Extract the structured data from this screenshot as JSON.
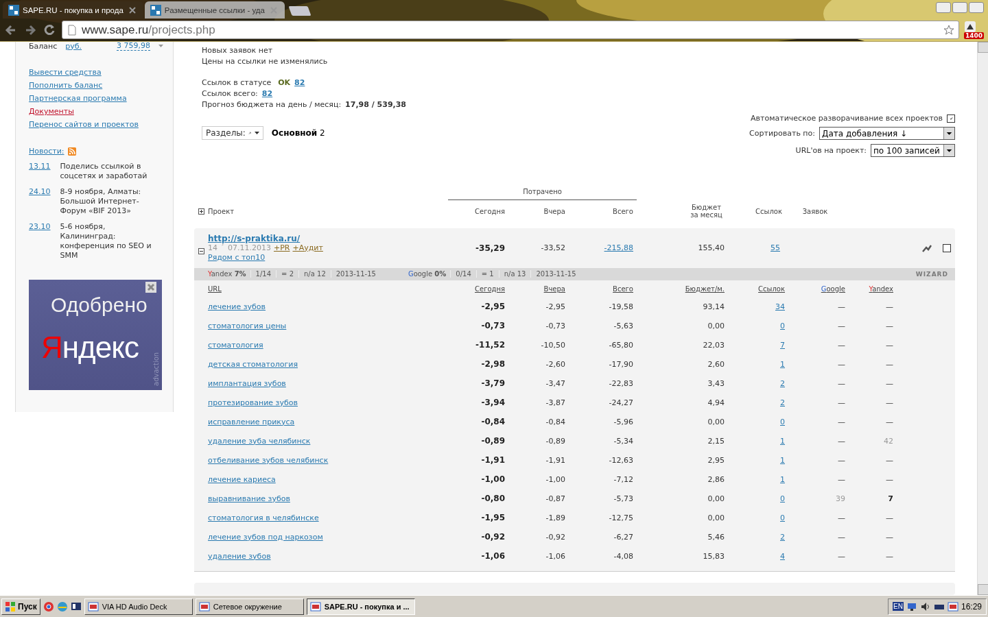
{
  "browser": {
    "tabs": [
      {
        "title": "SAPE.RU - покупка и прода",
        "selected": true
      },
      {
        "title": "Размещенные ссылки - уда",
        "selected": false
      }
    ],
    "url_host": "www.sape.ru",
    "url_path": "/projects.php",
    "extension_badge": "1400"
  },
  "sidebar": {
    "balance_label": "Баланс",
    "currency": "руб.",
    "balance": "3 759,98",
    "links": [
      {
        "label": "Вывести средства",
        "active": false
      },
      {
        "label": "Пополнить баланс",
        "active": false
      },
      {
        "label": "Партнерская программа",
        "active": false
      },
      {
        "label": "Документы",
        "active": true
      },
      {
        "label": "Перенос сайтов и проектов",
        "active": false
      }
    ],
    "news_title": "Новости:",
    "news": [
      {
        "date": "13.11",
        "text": "Поделись ссылкой в соцсетях и заработай"
      },
      {
        "date": "24.10",
        "text": "8-9 ноября, Алматы: Большой Интернет-Форум «BIF 2013»"
      },
      {
        "date": "23.10",
        "text": "5-6 ноября, Калининград: конференция по SEO и SMM"
      }
    ],
    "ad": {
      "line1": "Одобрено",
      "brand_initial": "Я",
      "brand_rest": "ндекс",
      "side": "advaction"
    }
  },
  "summary": {
    "lines": [
      "Новых заявок нет",
      "Цены на ссылки не изменялись"
    ],
    "status_label": "Ссылок в статусе",
    "status": "OK",
    "status_count": "82",
    "total_label": "Ссылок всего:",
    "total": "82",
    "forecast_label": "Прогноз бюджета на день / месяц:",
    "forecast": "17,98 / 539,38"
  },
  "controls": {
    "auto_expand": {
      "label": "Автоматическое разворачивание всех проектов",
      "checked": true
    },
    "sections_button": "Разделы:",
    "section_name": "Основной",
    "section_count": "2",
    "sort": {
      "label": "Сортировать по:",
      "value": "Дата добавления ↓"
    },
    "per_project": {
      "label": "URL'ов на проект:",
      "value": "по 100 записей"
    }
  },
  "table": {
    "group_header": "Потрачено",
    "columns": [
      "Проект",
      "Сегодня",
      "Вчера",
      "Всего",
      "Бюджет за месяц",
      "Ссылок",
      "Заявок"
    ],
    "project": {
      "url": "http://s-praktika.ru/",
      "expanded": true,
      "id": "14",
      "date": "07.11.2013",
      "tags": [
        "+PR",
        "+Аудит"
      ],
      "position": "Рядом с топ10",
      "today": "-35,29",
      "yesterday": "-33,52",
      "total": "-215,88",
      "budget": "155,40",
      "links": "55",
      "checked": false,
      "stats": [
        {
          "kind": "yandex",
          "initial": "Y",
          "rest": "andex",
          "percent": "7%",
          "items": [
            "1/14",
            "= 2",
            "n/a 12",
            "2013-11-15"
          ]
        },
        {
          "kind": "google",
          "initial": "G",
          "rest": "oogle",
          "percent": "0%",
          "items": [
            "0/14",
            "= 1",
            "n/a 13",
            "2013-11-15"
          ]
        }
      ],
      "wizard": "WIZARD"
    },
    "url_columns": [
      {
        "kind": "plain",
        "label": "URL"
      },
      {
        "kind": "plain",
        "label": "Сегодня"
      },
      {
        "kind": "plain",
        "label": "Вчера"
      },
      {
        "kind": "plain",
        "label": "Всего"
      },
      {
        "kind": "plain",
        "label": "Бюджет/м."
      },
      {
        "kind": "plain",
        "label": "Ссылок"
      },
      {
        "kind": "google",
        "initial": "G",
        "rest": "oogle"
      },
      {
        "kind": "yandex",
        "initial": "Y",
        "rest": "andex"
      }
    ],
    "rows": [
      {
        "keyword": "лечение зубов",
        "today": "-2,95",
        "yesterday": "-2,95",
        "total": "-19,58",
        "budget": "93,14",
        "links": "34",
        "google": {
          "value": "—",
          "kind": "none"
        },
        "yandex": {
          "value": "—",
          "kind": "none"
        }
      },
      {
        "keyword": "стоматология цены",
        "today": "-0,73",
        "yesterday": "-0,73",
        "total": "-5,63",
        "budget": "0,00",
        "links": "0",
        "google": {
          "value": "—",
          "kind": "none"
        },
        "yandex": {
          "value": "—",
          "kind": "none"
        }
      },
      {
        "keyword": "стоматология",
        "today": "-11,52",
        "yesterday": "-10,50",
        "total": "-65,80",
        "budget": "22,03",
        "links": "7",
        "google": {
          "value": "—",
          "kind": "none"
        },
        "yandex": {
          "value": "—",
          "kind": "none"
        }
      },
      {
        "keyword": "детская стоматология",
        "today": "-2,98",
        "yesterday": "-2,60",
        "total": "-17,90",
        "budget": "2,60",
        "links": "1",
        "google": {
          "value": "—",
          "kind": "none"
        },
        "yandex": {
          "value": "—",
          "kind": "none"
        }
      },
      {
        "keyword": "имплантация зубов",
        "today": "-3,79",
        "yesterday": "-3,47",
        "total": "-22,83",
        "budget": "3,43",
        "links": "2",
        "google": {
          "value": "—",
          "kind": "none"
        },
        "yandex": {
          "value": "—",
          "kind": "none"
        }
      },
      {
        "keyword": "протезирование зубов",
        "today": "-3,94",
        "yesterday": "-3,87",
        "total": "-24,27",
        "budget": "4,94",
        "links": "2",
        "google": {
          "value": "—",
          "kind": "none"
        },
        "yandex": {
          "value": "—",
          "kind": "none"
        }
      },
      {
        "keyword": "исправление прикуса",
        "today": "-0,84",
        "yesterday": "-0,84",
        "total": "-5,96",
        "budget": "0,00",
        "links": "0",
        "google": {
          "value": "—",
          "kind": "none"
        },
        "yandex": {
          "value": "—",
          "kind": "none"
        }
      },
      {
        "keyword": "удаление зуба челябинск",
        "today": "-0,89",
        "yesterday": "-0,89",
        "total": "-5,34",
        "budget": "2,15",
        "links": "1",
        "google": {
          "value": "—",
          "kind": "none"
        },
        "yandex": {
          "value": "42",
          "kind": "position"
        }
      },
      {
        "keyword": "отбеливание зубов челябинск",
        "today": "-1,91",
        "yesterday": "-1,91",
        "total": "-12,63",
        "budget": "2,95",
        "links": "1",
        "google": {
          "value": "—",
          "kind": "none"
        },
        "yandex": {
          "value": "—",
          "kind": "none"
        }
      },
      {
        "keyword": "лечение кариеса",
        "today": "-1,00",
        "yesterday": "-1,00",
        "total": "-7,12",
        "budget": "2,86",
        "links": "1",
        "google": {
          "value": "—",
          "kind": "none"
        },
        "yandex": {
          "value": "—",
          "kind": "none"
        }
      },
      {
        "keyword": "выравнивание зубов",
        "today": "-0,80",
        "yesterday": "-0,87",
        "total": "-5,73",
        "budget": "0,00",
        "links": "0",
        "google": {
          "value": "39",
          "kind": "position"
        },
        "yandex": {
          "value": "7",
          "kind": "top"
        }
      },
      {
        "keyword": "стоматология в челябинске",
        "today": "-1,95",
        "yesterday": "-1,89",
        "total": "-12,75",
        "budget": "0,00",
        "links": "0",
        "google": {
          "value": "—",
          "kind": "none"
        },
        "yandex": {
          "value": "—",
          "kind": "none"
        }
      },
      {
        "keyword": "лечение зубов под наркозом",
        "today": "-0,92",
        "yesterday": "-0,92",
        "total": "-6,27",
        "budget": "5,46",
        "links": "2",
        "google": {
          "value": "—",
          "kind": "none"
        },
        "yandex": {
          "value": "—",
          "kind": "none"
        }
      },
      {
        "keyword": "удаление зубов",
        "today": "-1,06",
        "yesterday": "-1,06",
        "total": "-4,08",
        "budget": "15,83",
        "links": "4",
        "google": {
          "value": "—",
          "kind": "none"
        },
        "yandex": {
          "value": "—",
          "kind": "none"
        }
      }
    ]
  },
  "taskbar": {
    "start": "Пуск",
    "tasks": [
      {
        "title": "VIA HD Audio Deck",
        "selected": false
      },
      {
        "title": "Сетевое окружение",
        "selected": false
      },
      {
        "title": "SAPE.RU - покупка и ...",
        "selected": true
      }
    ],
    "language": "EN",
    "clock": "16:29"
  }
}
